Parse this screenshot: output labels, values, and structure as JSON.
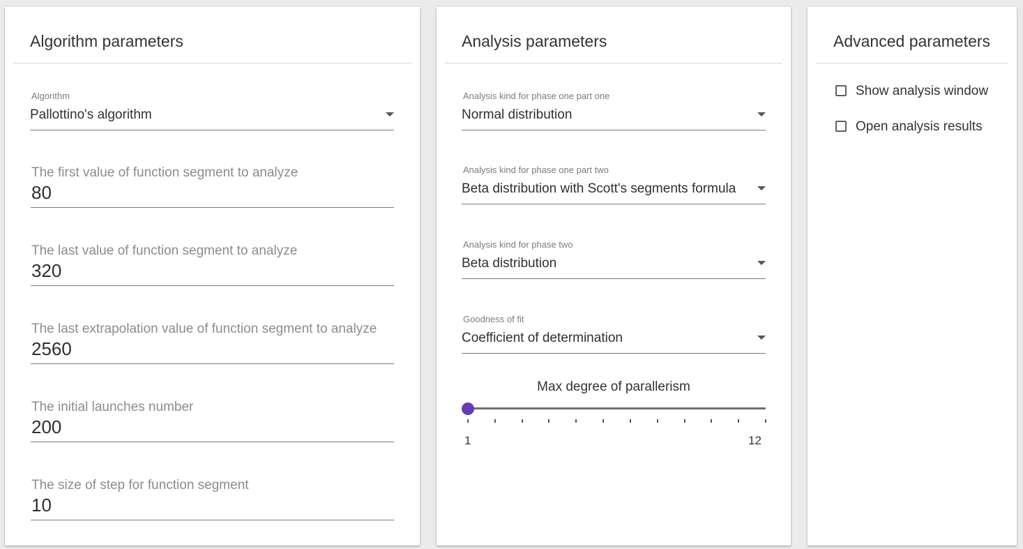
{
  "algorithm_panel": {
    "title": "Algorithm parameters",
    "algorithm": {
      "label": "Algorithm",
      "value": "Pallottino's algorithm"
    },
    "fields": [
      {
        "label": "The first value of function segment to analyze",
        "value": "80"
      },
      {
        "label": "The last value of function segment to analyze",
        "value": "320"
      },
      {
        "label": "The last extrapolation value of function segment to analyze",
        "value": "2560"
      },
      {
        "label": "The initial launches number",
        "value": "200"
      },
      {
        "label": "The size of step for function segment",
        "value": "10"
      }
    ]
  },
  "analysis_panel": {
    "title": "Analysis parameters",
    "selects": [
      {
        "label": "Analysis kind for phase one part one",
        "value": "Normal distribution"
      },
      {
        "label": "Analysis kind for phase one part two",
        "value": "Beta distribution with Scott's segments formula"
      },
      {
        "label": "Analysis kind for phase two",
        "value": "Beta distribution"
      },
      {
        "label": "Goodness of fit",
        "value": "Coefficient of determination"
      }
    ],
    "slider": {
      "title": "Max degree of parallerism",
      "min_label": "1",
      "max_label": "12",
      "min": 1,
      "max": 12,
      "value": 1,
      "thumb_color": "#673ab7"
    }
  },
  "advanced_panel": {
    "title": "Advanced parameters",
    "checkboxes": [
      {
        "label": "Show analysis window",
        "checked": false
      },
      {
        "label": "Open analysis results",
        "checked": false
      }
    ]
  }
}
